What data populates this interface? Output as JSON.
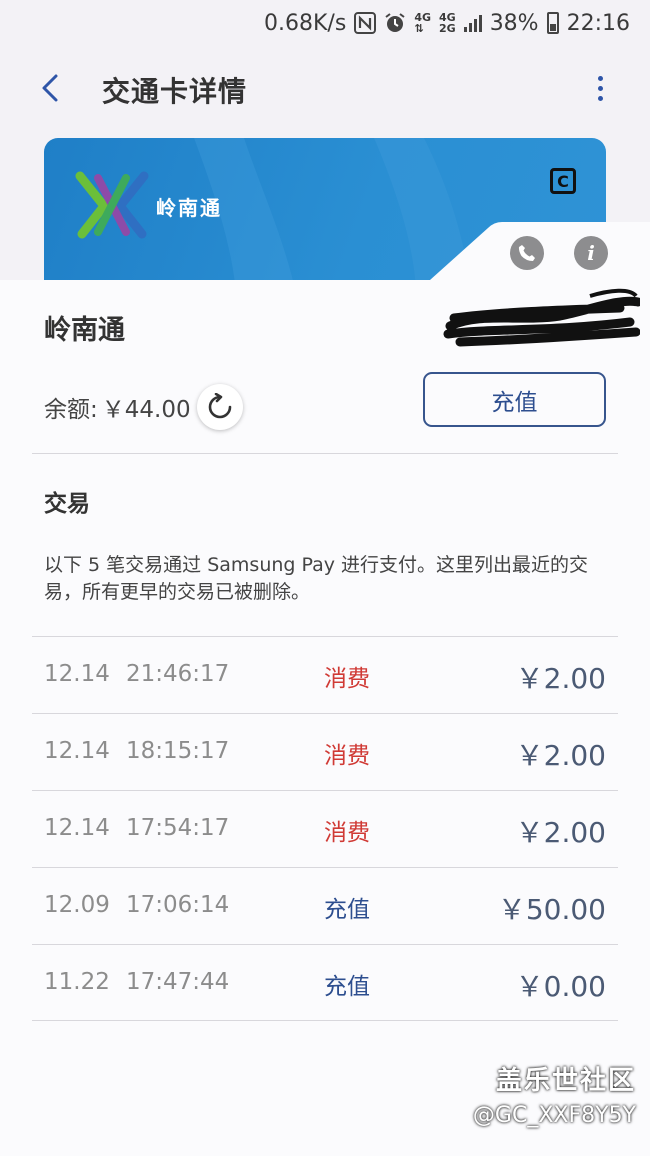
{
  "status_bar": {
    "speed": "0.68K/s",
    "net_top": "4G",
    "net2_top": "4G",
    "net2_bottom": "2G",
    "battery": "38%",
    "time": "22:16"
  },
  "header": {
    "title": "交通卡详情",
    "back_icon": "chevron-left-icon",
    "more_icon": "more-vertical-icon"
  },
  "card": {
    "name": "岭南通",
    "badge": "C"
  },
  "details": {
    "card_title": "岭南通",
    "balance_label": "余额:",
    "balance_value": "￥44.00",
    "topup_label": "充值",
    "section_title": "交易",
    "description": "以下 5 笔交易通过 Samsung Pay 进行支付。这里列出最近的交易，所有更早的交易已被删除。"
  },
  "transactions": [
    {
      "date": "12.14",
      "time": "21:46:17",
      "type": "消费",
      "amount": "￥2.00"
    },
    {
      "date": "12.14",
      "time": "18:15:17",
      "type": "消费",
      "amount": "￥2.00"
    },
    {
      "date": "12.14",
      "time": "17:54:17",
      "type": "消费",
      "amount": "￥2.00"
    },
    {
      "date": "12.09",
      "time": "17:06:14",
      "type": "充值",
      "amount": "￥50.00"
    },
    {
      "date": "11.22",
      "time": "17:47:44",
      "type": "充值",
      "amount": "￥0.00"
    }
  ],
  "watermark": {
    "line1": "盖乐世社区",
    "line2": "@GC_XXF8Y5Y"
  },
  "colors": {
    "accent": "#2d4e8f",
    "spend": "#d03a35",
    "card": "#1f7fc7"
  }
}
